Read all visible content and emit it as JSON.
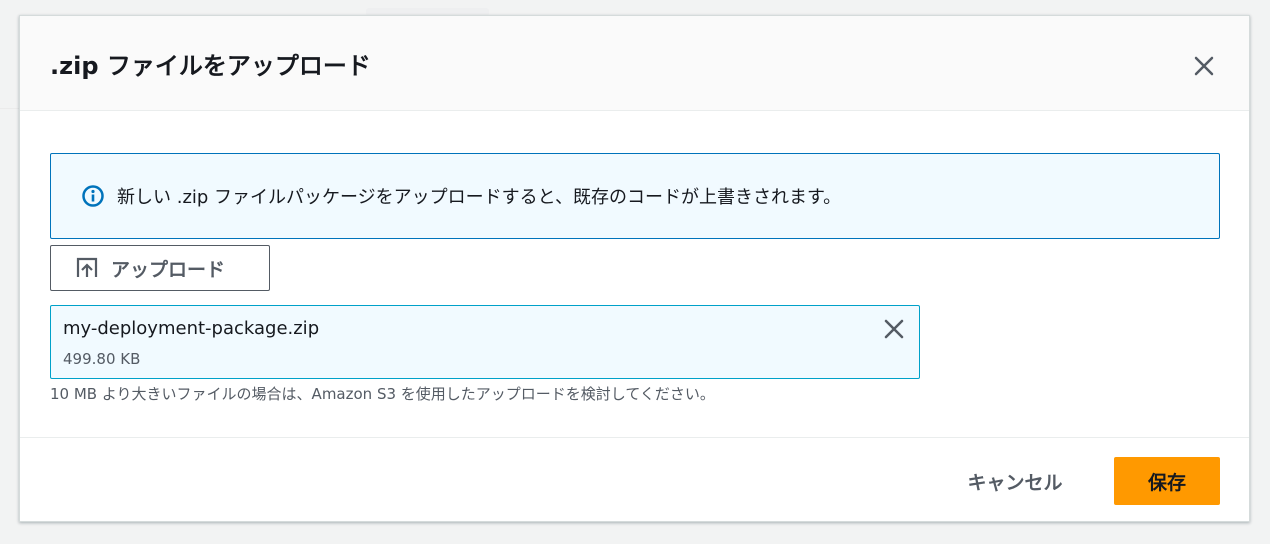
{
  "modal": {
    "title": ".zip ファイルをアップロード",
    "close_icon": "close-icon"
  },
  "info_alert": {
    "icon": "info-icon",
    "text": "新しい .zip ファイルパッケージをアップロードすると、既存のコードが上書きされます。",
    "color": "#0073bb"
  },
  "upload_button": {
    "icon": "upload-icon",
    "label": "アップロード"
  },
  "file": {
    "name": "my-deployment-package.zip",
    "size": "499.80 KB",
    "remove_icon": "close-icon"
  },
  "hint": "10 MB より大きいファイルの場合は、Amazon S3 を使用したアップロードを検討してください。",
  "footer": {
    "cancel_label": "キャンセル",
    "save_label": "保存",
    "save_color": "#ff9900"
  }
}
